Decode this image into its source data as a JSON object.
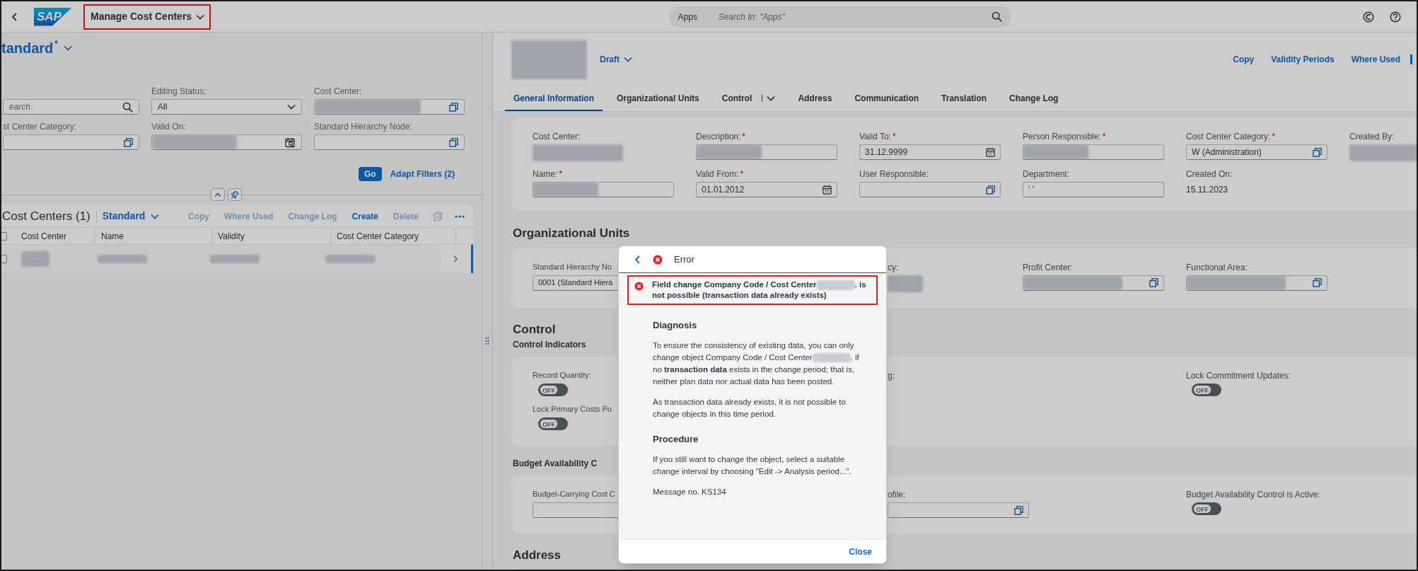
{
  "shell": {
    "logo": "SAP",
    "title": "Manage Cost Centers",
    "title_highlighted": true,
    "search_scope": "Apps",
    "search_placeholder": "Search In: \"Apps\""
  },
  "filter_bar": {
    "variant": "tandard",
    "variant_modified": "*",
    "filters": [
      {
        "kind": "search",
        "placeholder": "earch"
      },
      {
        "kind": "select",
        "label": "Editing Status:",
        "value": "All"
      },
      {
        "kind": "valuehelp",
        "label": "Cost Center:",
        "redacted": true
      },
      {
        "kind": "valuehelp",
        "label": "st Center Category:"
      },
      {
        "kind": "datesearch",
        "label": "Valid On:",
        "redacted": true
      },
      {
        "kind": "valuehelp",
        "label": "Standard Hierarchy Node:"
      }
    ],
    "go": "Go",
    "adapt": "Adapt Filters (2)"
  },
  "table": {
    "title": "Cost Centers (1)",
    "variant": "Standard",
    "select_all_checked": false,
    "actions": [
      {
        "label": "Copy",
        "disabled": true
      },
      {
        "label": "Where Used",
        "disabled": true
      },
      {
        "label": "Change Log",
        "disabled": true
      },
      {
        "label": "Create",
        "disabled": false
      },
      {
        "label": "Delete",
        "disabled": true
      }
    ],
    "columns": [
      "Cost Center",
      "Name",
      "Validity",
      "Cost Center Category"
    ],
    "rows": [
      {
        "redacted": true,
        "navigated": true,
        "checked": false
      }
    ]
  },
  "object": {
    "status": "Draft",
    "actions": [
      "Copy",
      "Validity Periods",
      "Where Used"
    ],
    "tabs": [
      {
        "label": "General Information",
        "selected": true
      },
      {
        "label": "Organizational Units",
        "selected": false
      },
      {
        "label": "Control",
        "selected": false,
        "kind": "menu"
      },
      {
        "label": "Address",
        "selected": false
      },
      {
        "label": "Communication",
        "selected": false
      },
      {
        "label": "Translation",
        "selected": false
      },
      {
        "label": "Change Log",
        "selected": false
      }
    ],
    "general": [
      {
        "label": "Cost Center:",
        "kind": "text",
        "redacted": true
      },
      {
        "label": "Description:",
        "required": true,
        "kind": "input",
        "redacted": true
      },
      {
        "label": "Valid To:",
        "required": true,
        "kind": "date",
        "value": "31.12.9999"
      },
      {
        "label": "Person Responsible:",
        "required": true,
        "kind": "input",
        "redacted": true
      },
      {
        "label": "Cost Center Category:",
        "required": true,
        "kind": "valuehelp",
        "value": "W (Administration)"
      },
      {
        "label": "Created By:",
        "kind": "text",
        "redacted": true
      },
      {
        "label": "Name:",
        "required": true,
        "kind": "input",
        "redacted": true
      },
      {
        "label": "Valid From:",
        "required": true,
        "kind": "date",
        "value": "01.01.2012"
      },
      {
        "label": "User Responsible:",
        "kind": "valuehelp"
      },
      {
        "label": "Department:",
        "kind": "input",
        "value": "' '"
      },
      {
        "label": "Created On:",
        "kind": "text",
        "value": "15.11.2023"
      }
    ],
    "sections": [
      {
        "title": "Organizational Units",
        "fields": [
          {
            "label": "Standard Hierarchy No",
            "kind": "input",
            "value": "0001 (Standard Hiera"
          },
          {
            "kind": "none"
          },
          {
            "label": "cy:",
            "kind": "text",
            "redacted": true
          },
          {
            "label": "Profit Center:",
            "kind": "valuehelp",
            "redacted": true
          },
          {
            "label": "Functional Area:",
            "kind": "valuehelp",
            "redacted": true
          }
        ]
      },
      {
        "title": "Control",
        "subtitle": "Control Indicators",
        "fields": [
          {
            "label": "Record Quantity:",
            "kind": "switch",
            "on": false,
            "value": "OFF"
          },
          {
            "kind": "none"
          },
          {
            "label": "g:",
            "kind": "none"
          },
          {
            "kind": "none"
          },
          {
            "label": "Lock Commitment Updates:",
            "kind": "switch",
            "on": false,
            "value": "OFF"
          },
          {
            "kind": "none"
          },
          {
            "label": "Lock Primary Costs Po",
            "kind": "switch",
            "on": false,
            "value": "OFF"
          }
        ]
      },
      {
        "subtitle": "Budget Availability C",
        "fields": [
          {
            "label": "Budget-Carrying Cost C",
            "kind": "input"
          },
          {
            "kind": "none"
          },
          {
            "label": "ofile:",
            "kind": "valuehelp"
          },
          {
            "kind": "none"
          },
          {
            "label": "Budget Availability Control is Active:",
            "kind": "switch",
            "on": false,
            "value": "OFF"
          }
        ]
      },
      {
        "title": "Address"
      }
    ]
  },
  "dialog": {
    "title": "Error",
    "message_highlighted": true,
    "message_before": "Field change Company Code / Cost Center",
    "message_after": ". is not possible (transaction data already exists)",
    "blocks": [
      {
        "kind": "heading",
        "text": "Diagnosis"
      },
      {
        "kind": "redacted_paragraph",
        "before": "To ensure the consistency of existing data, you can only change object Company Code / Cost Center",
        "after": ". if no **transaction data** exists in the change period; that is, neither plan data nor actual data has been posted."
      },
      {
        "kind": "paragraph",
        "text": "As transaction data already exists, it is not possible to change objects in this time period."
      },
      {
        "kind": "heading",
        "text": "Procedure"
      },
      {
        "kind": "paragraph",
        "text": "If you still want to change the object, select a suitable change interval by choosing \"Edit -> Analysis period...\"."
      },
      {
        "kind": "paragraph",
        "text": "Message no. KS134"
      }
    ],
    "close": "Close"
  }
}
